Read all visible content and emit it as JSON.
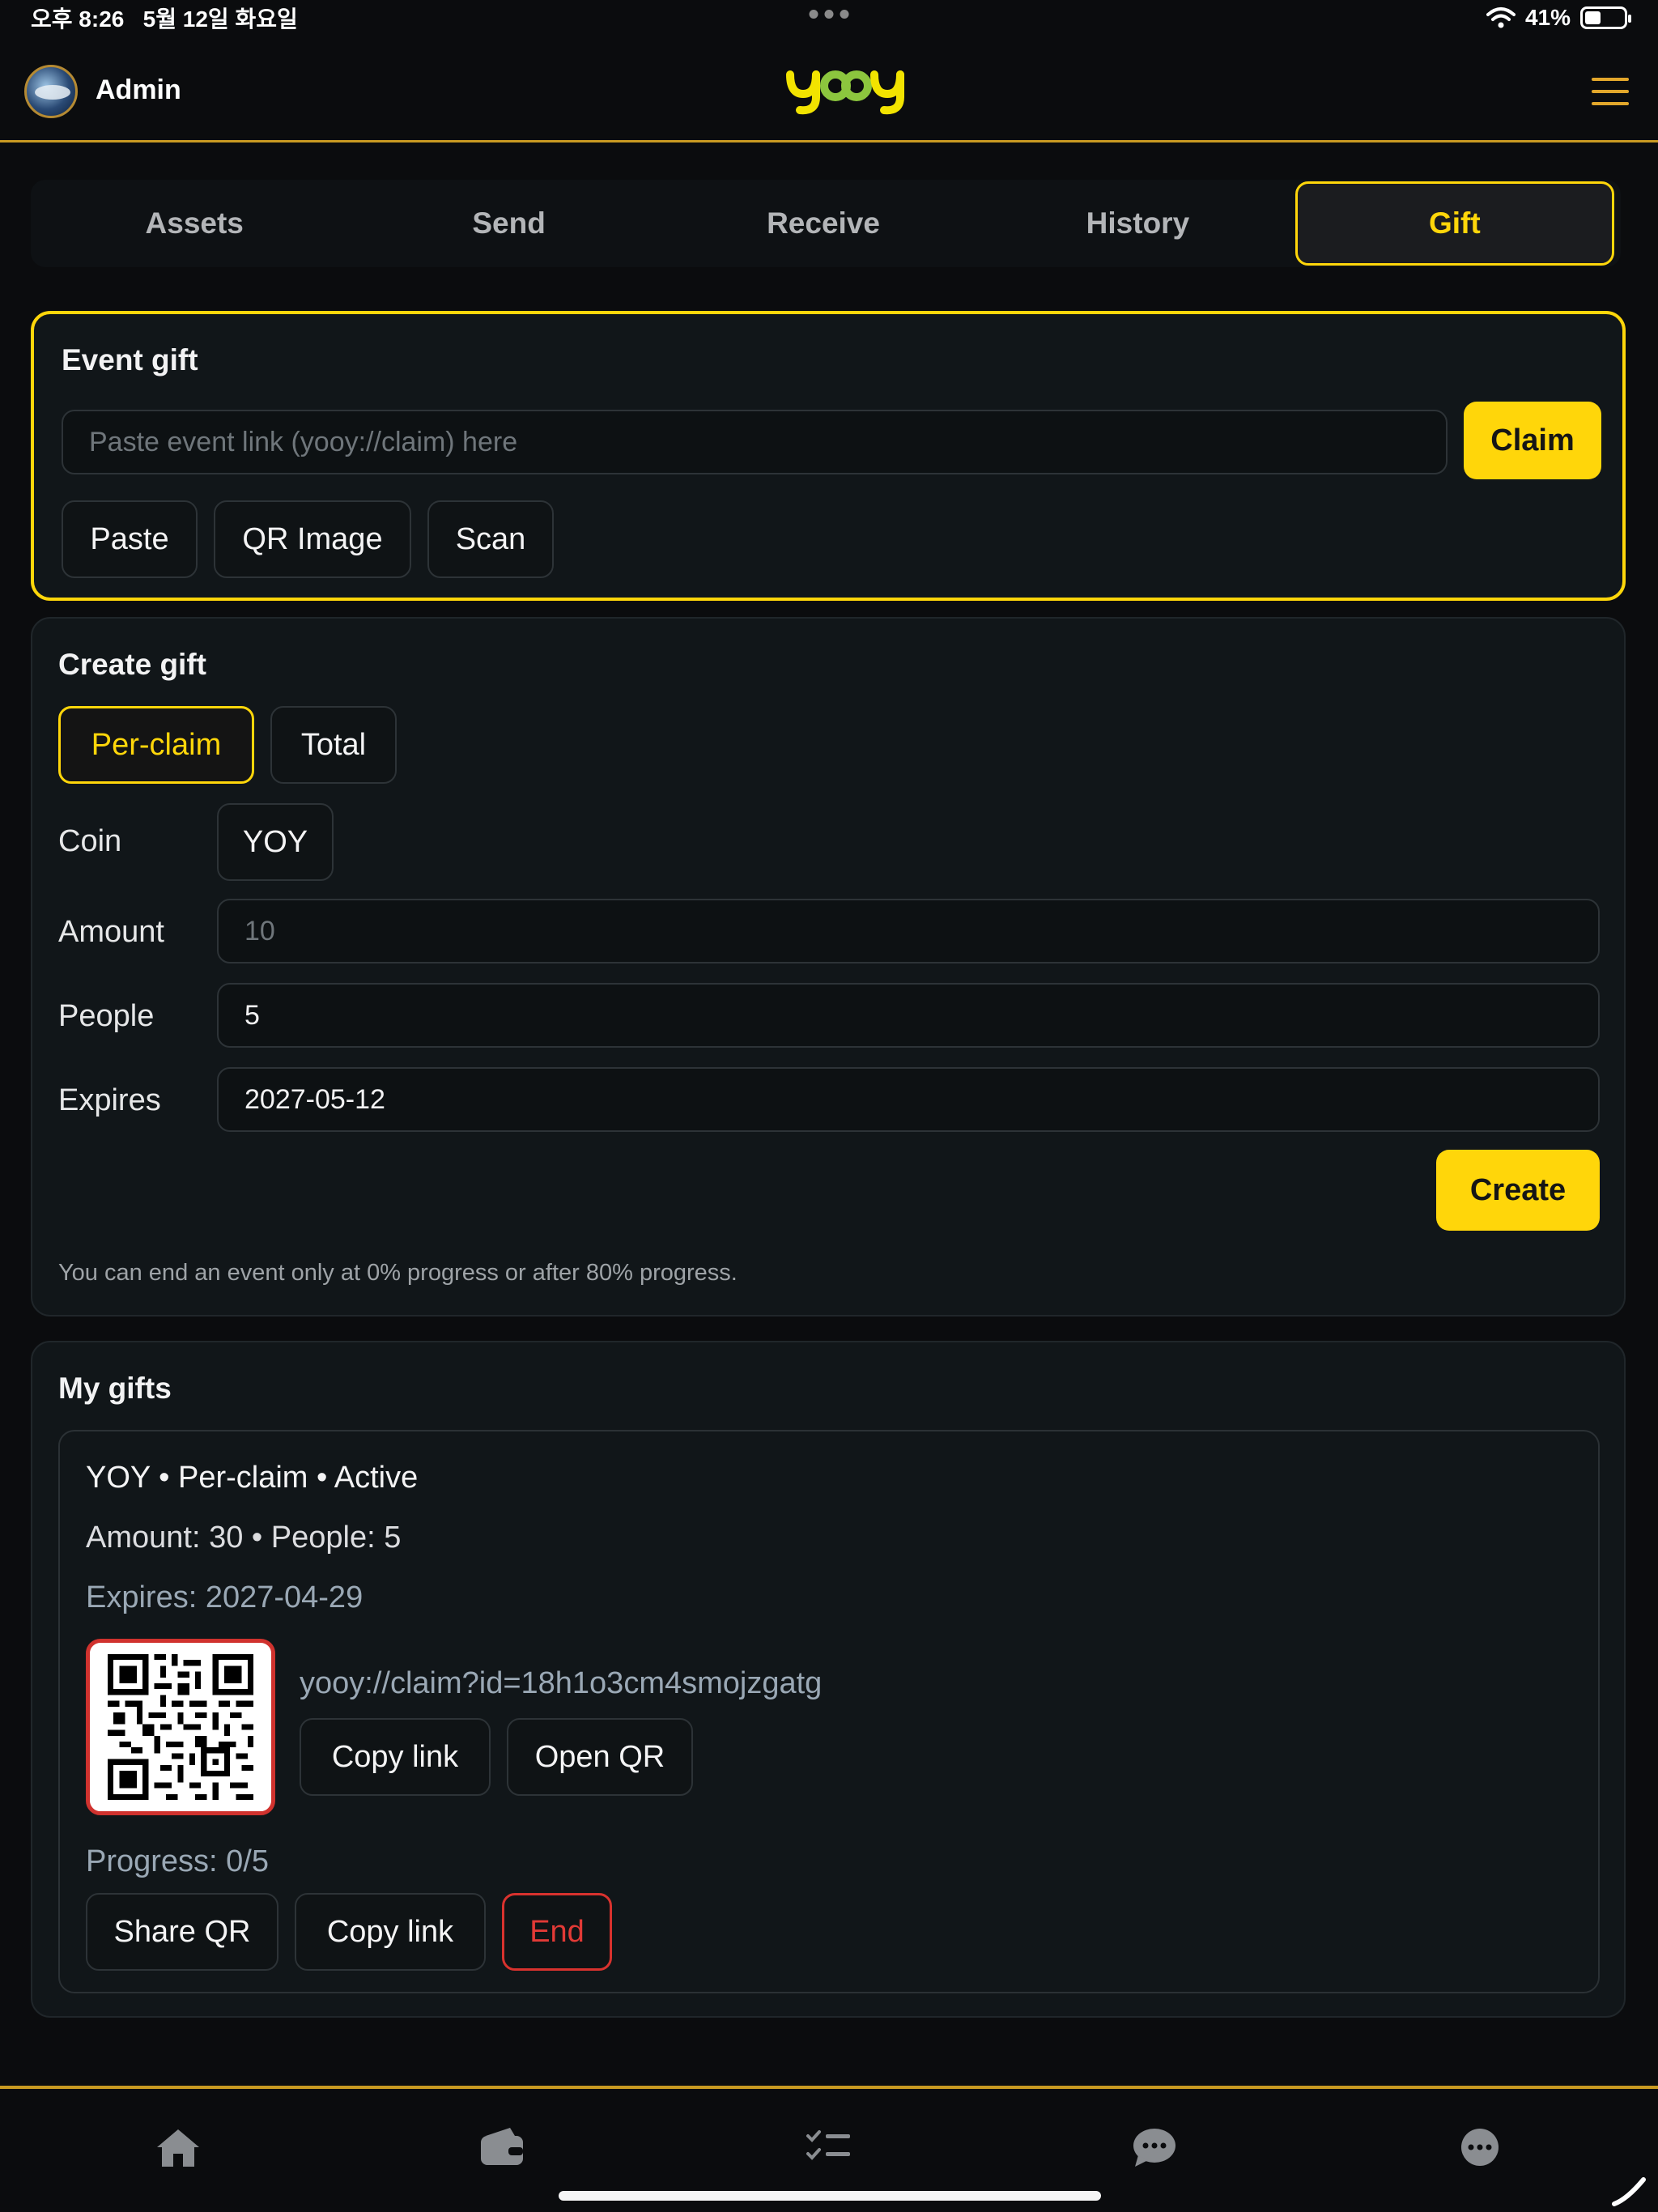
{
  "status_bar": {
    "left": "오후 8:26   5월 12일 화요일",
    "battery": "41%"
  },
  "header": {
    "user_name": "Admin",
    "logo_text": "yooy"
  },
  "tabs": [
    {
      "label": "Assets"
    },
    {
      "label": "Send"
    },
    {
      "label": "Receive"
    },
    {
      "label": "History"
    },
    {
      "label": "Gift",
      "active": true
    }
  ],
  "event_gift": {
    "title": "Event gift",
    "link_placeholder": "Paste event link (yooy://claim) here",
    "claim_label": "Claim",
    "paste_label": "Paste",
    "qr_image_label": "QR Image",
    "scan_label": "Scan"
  },
  "create_gift": {
    "title": "Create gift",
    "mode_options": [
      "Per-claim",
      "Total"
    ],
    "selected_mode": "Per-claim",
    "coin_label": "Coin",
    "coin_value": "YOY",
    "amount_label": "Amount",
    "amount_placeholder": "10",
    "people_label": "People",
    "people_value": "5",
    "expires_label": "Expires",
    "expires_value": "2027-05-12",
    "create_label": "Create",
    "note": "You can end an event only at 0% progress or after 80% progress."
  },
  "my_gifts": {
    "title": "My gifts",
    "items": [
      {
        "summary": "YOY • Per-claim • Active",
        "amount_people": "Amount: 30 • People: 5",
        "expires": "Expires: 2027-04-29",
        "link": "yooy://claim?id=18h1o3cm4smojzgatg",
        "copy_link_label": "Copy link",
        "open_qr_label": "Open QR",
        "progress": "Progress: 0/5",
        "share_qr_label": "Share QR",
        "copy_link_label_2": "Copy link",
        "end_label": "End"
      }
    ]
  },
  "bottom_nav": [
    "home-icon",
    "wallet-icon",
    "checklist-icon",
    "chat-icon",
    "more-icon"
  ],
  "colors": {
    "accent": "#ffd60a",
    "header_border": "#c99a22",
    "danger": "#e23a36"
  }
}
